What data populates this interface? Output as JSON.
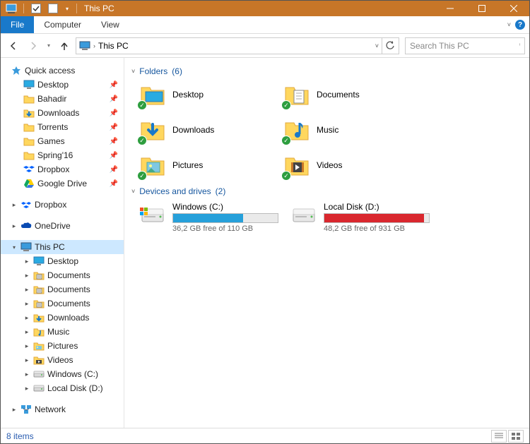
{
  "window": {
    "title": "This PC"
  },
  "ribbon": {
    "file": "File",
    "computer": "Computer",
    "view": "View"
  },
  "address": {
    "location": "This PC"
  },
  "search": {
    "placeholder": "Search This PC"
  },
  "sidebar": {
    "quick_access": {
      "label": "Quick access",
      "items": [
        {
          "label": "Desktop",
          "icon": "desktop"
        },
        {
          "label": "Bahadir",
          "icon": "folder"
        },
        {
          "label": "Downloads",
          "icon": "downloads"
        },
        {
          "label": "Torrents",
          "icon": "folder"
        },
        {
          "label": "Games",
          "icon": "folder"
        },
        {
          "label": "Spring'16",
          "icon": "folder"
        },
        {
          "label": "Dropbox",
          "icon": "dropbox"
        },
        {
          "label": "Google Drive",
          "icon": "gdrive"
        }
      ]
    },
    "dropbox": {
      "label": "Dropbox"
    },
    "onedrive": {
      "label": "OneDrive"
    },
    "this_pc": {
      "label": "This PC",
      "items": [
        {
          "label": "Desktop",
          "icon": "desktop"
        },
        {
          "label": "Documents",
          "icon": "documents"
        },
        {
          "label": "Documents",
          "icon": "documents"
        },
        {
          "label": "Documents",
          "icon": "documents"
        },
        {
          "label": "Downloads",
          "icon": "downloads"
        },
        {
          "label": "Music",
          "icon": "music"
        },
        {
          "label": "Pictures",
          "icon": "pictures"
        },
        {
          "label": "Videos",
          "icon": "videos"
        },
        {
          "label": "Windows (C:)",
          "icon": "disk"
        },
        {
          "label": "Local Disk (D:)",
          "icon": "disk"
        }
      ]
    },
    "network": {
      "label": "Network"
    }
  },
  "content": {
    "folders": {
      "title": "Folders",
      "count": "(6)",
      "items": [
        {
          "label": "Desktop",
          "icon": "desktop"
        },
        {
          "label": "Documents",
          "icon": "documents"
        },
        {
          "label": "Downloads",
          "icon": "downloads"
        },
        {
          "label": "Music",
          "icon": "music"
        },
        {
          "label": "Pictures",
          "icon": "pictures"
        },
        {
          "label": "Videos",
          "icon": "videos"
        }
      ]
    },
    "drives": {
      "title": "Devices and drives",
      "count": "(2)",
      "items": [
        {
          "name": "Windows (C:)",
          "free_text": "36,2 GB free of 110 GB",
          "used_pct": 67,
          "color": "#26a0da"
        },
        {
          "name": "Local Disk (D:)",
          "free_text": "48,2 GB free of 931 GB",
          "used_pct": 95,
          "color": "#d9272e"
        }
      ]
    }
  },
  "statusbar": {
    "items": "8 items"
  }
}
